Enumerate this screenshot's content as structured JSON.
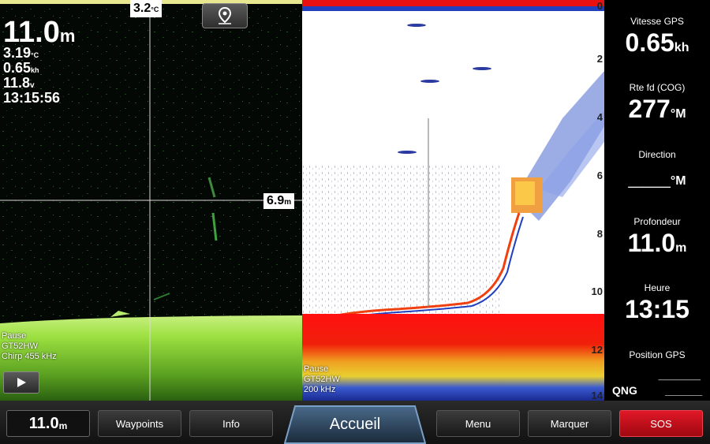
{
  "left_panel": {
    "depth_value": "11.0",
    "depth_unit": "m",
    "water_temp": "3.19",
    "water_temp_unit": "°C",
    "speed": "0.65",
    "speed_unit": "kh",
    "voltage": "11.8",
    "voltage_unit": "v",
    "time": "13:15:56",
    "crosshair_temp": "3.2",
    "crosshair_temp_unit": "°C",
    "crosshair_depth": "6.9",
    "crosshair_depth_unit": "m",
    "status_lines": [
      "Pause",
      "GT52HW",
      "Chirp 455 kHz"
    ],
    "play_icon": "play-icon",
    "waypoint_icon": "map-pin-icon"
  },
  "right_panel": {
    "depth_scale": [
      "0",
      "2",
      "4",
      "6",
      "8",
      "10",
      "12",
      "14"
    ],
    "status_lines": [
      "Pause",
      "GT52HW",
      "200 kHz"
    ]
  },
  "sidebar": {
    "fields": [
      {
        "label": "Vitesse GPS",
        "value": "0.65",
        "unit": "kh"
      },
      {
        "label": "Rte fd (COG)",
        "value": "277",
        "unit": "°M"
      },
      {
        "label": "Direction",
        "value": "___",
        "unit": "°M"
      },
      {
        "label": "Profondeur",
        "value": "11.0",
        "unit": "m"
      },
      {
        "label": "Heure",
        "value": "13:15",
        "unit": ""
      },
      {
        "label": "Position GPS",
        "value": "______",
        "unit": ""
      }
    ],
    "position_prefix": "QNG",
    "position_value2": "______"
  },
  "bottom_bar": {
    "depth_value": "11.0",
    "depth_unit": "m",
    "buttons": [
      "Waypoints",
      "Info",
      "Accueil",
      "Menu",
      "Marquer",
      "SOS"
    ],
    "colors": {
      "sos": "#cc1020",
      "accent": "#5a8ab8"
    }
  }
}
